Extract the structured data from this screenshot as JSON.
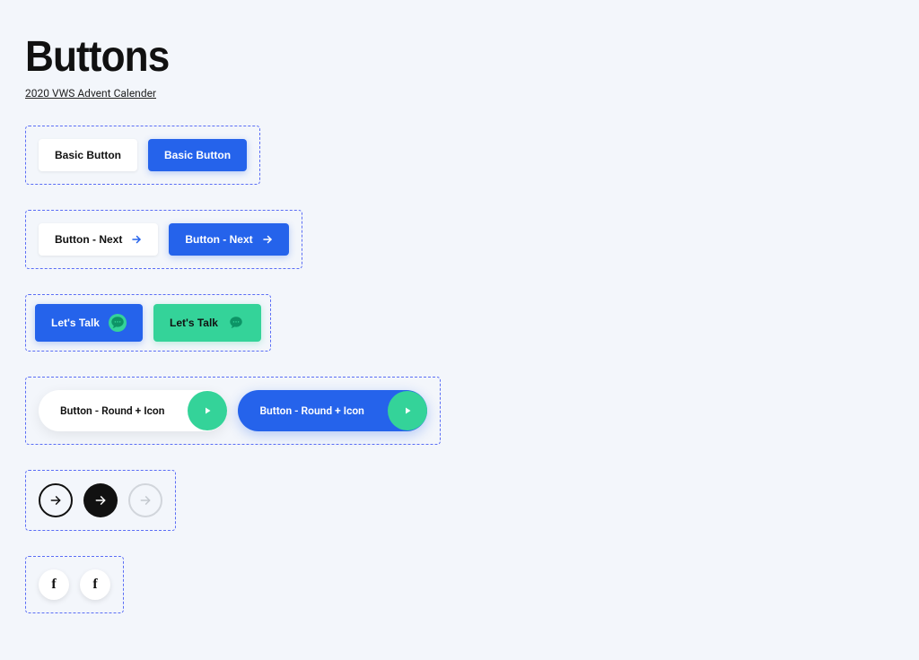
{
  "header": {
    "title": "Buttons",
    "subtitle": "2020 VWS Advent Calender"
  },
  "colors": {
    "blue": "#2563eb",
    "green": "#34d399",
    "background": "#f3f6fb"
  },
  "groups": {
    "basic": {
      "white_label": "Basic Button",
      "blue_label": "Basic Button"
    },
    "next": {
      "white_label": "Button - Next",
      "blue_label": "Button - Next",
      "icon": "arrow-right"
    },
    "talk": {
      "blue_label": "Let's Talk",
      "green_label": "Let's Talk",
      "icon": "chat-bubble"
    },
    "round": {
      "white_label": "Button - Round + Icon",
      "blue_label": "Button - Round + Icon",
      "icon": "play"
    },
    "circles": {
      "icon": "arrow-right",
      "variants": [
        "outline",
        "black",
        "grey"
      ]
    },
    "social": {
      "icon": "facebook",
      "glyph": "f",
      "count": 2
    }
  }
}
